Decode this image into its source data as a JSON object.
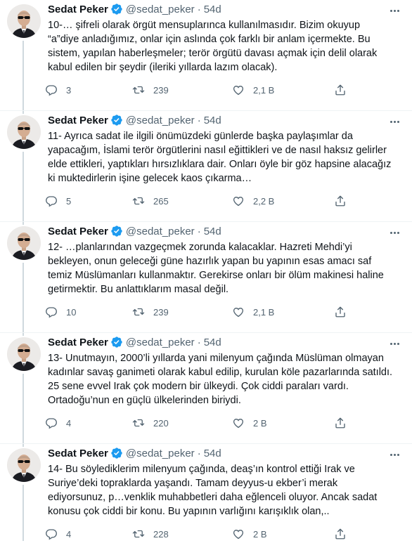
{
  "colors": {
    "accent": "#1d9bf0",
    "text": "#0f1419",
    "muted": "#536471",
    "divider": "#eff3f4"
  },
  "icons": {
    "reply": "reply-icon",
    "retweet": "retweet-icon",
    "like": "like-icon",
    "share": "share-icon",
    "verified": "verified-badge-icon",
    "more": "more-icon"
  },
  "tweets": [
    {
      "name": "Sedat Peker",
      "handle": "@sedat_peker",
      "dot": "·",
      "time": "54d",
      "text": "10-… şifreli olarak örgüt mensuplarınca kullanılmasıdır. Bizim okuyup\n“a”diye anladığımız, onlar için aslında çok farklı bir anlam içermekte. Bu\nsistem, yapılan haberleşmeler; terör örgütü davası açmak için delil olarak\nkabul edilen bir şeydir (ileriki yıllarda lazım olacak).",
      "replies": "3",
      "retweets": "239",
      "likes": "2,1 B"
    },
    {
      "name": "Sedat Peker",
      "handle": "@sedat_peker",
      "dot": "·",
      "time": "54d",
      "text": "11- Ayrıca sadat ile ilgili önümüzdeki günlerde başka paylaşımlar da\nyapacağım, İslami terör örgütlerini nasıl eğittikleri ve de nasıl haksız gelirler\nelde ettikleri, yaptıkları hırsızlıklara dair. Onları öyle bir göz hapsine alacağız\nki muktedirlerin işine gelecek kaos çıkarma…",
      "replies": "5",
      "retweets": "265",
      "likes": "2,2 B"
    },
    {
      "name": "Sedat Peker",
      "handle": "@sedat_peker",
      "dot": "·",
      "time": "54d",
      "text": "12- …planlarından vazgeçmek zorunda kalacaklar. Hazreti Mehdi’yi\nbekleyen, onun geleceği güne hazırlık yapan bu yapının esas amacı saf\ntemiz Müslümanları kullanmaktır. Gerekirse onları bir ölüm makinesi haline\ngetirmektir. Bu anlattıklarım masal değil.",
      "replies": "10",
      "retweets": "239",
      "likes": "2,1 B"
    },
    {
      "name": "Sedat Peker",
      "handle": "@sedat_peker",
      "dot": "·",
      "time": "54d",
      "text": "13- Unutmayın, 2000’li yıllarda yani milenyum çağında Müslüman olmayan\nkadınlar savaş ganimeti olarak kabul edilip, kurulan köle pazarlarında satıldı.\n25 sene evvel Irak çok modern bir ülkeydi. Çok ciddi paraları vardı.\nOrtadoğu’nun en güçlü ülkelerinden biriydi.",
      "replies": "4",
      "retweets": "220",
      "likes": "2 B"
    },
    {
      "name": "Sedat Peker",
      "handle": "@sedat_peker",
      "dot": "·",
      "time": "54d",
      "text": "14- Bu söylediklerim milenyum çağında, deaş’ın kontrol ettiği Irak ve\nSuriye’deki topraklarda yaşandı. Tamam deyyus-u ekber’i merak\nediyorsunuz, p…venklik muhabbetleri daha eğlenceli oluyor. Ancak sadat\nkonusu çok ciddi bir konu. Bu yapının varlığını karışıklık olan,..",
      "replies": "4",
      "retweets": "228",
      "likes": "2 B"
    }
  ]
}
